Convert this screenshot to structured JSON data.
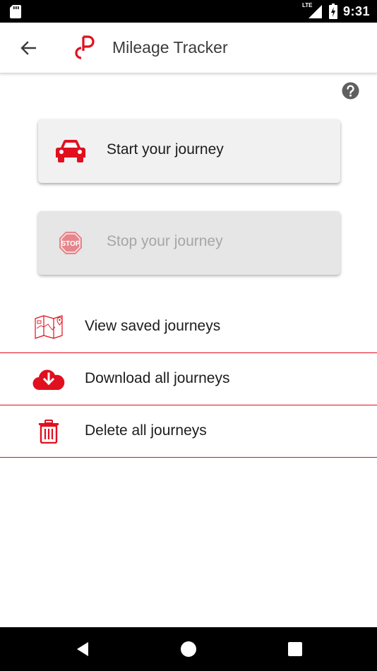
{
  "status_bar": {
    "network": "LTE",
    "time": "9:31",
    "icons": [
      "sd-card-icon",
      "signal-icon",
      "battery-charging-icon"
    ]
  },
  "app_bar": {
    "title": "Mileage Tracker",
    "back_icon": "arrow-back-icon",
    "logo_icon": "app-logo-icon"
  },
  "help_icon": "help-circle-icon",
  "journey_buttons": {
    "start": {
      "label": "Start your journey",
      "icon": "car-icon",
      "enabled": true
    },
    "stop": {
      "label": "Stop your journey",
      "icon": "stop-sign-icon",
      "icon_text": "STOP",
      "enabled": false
    }
  },
  "menu": [
    {
      "label": "View saved journeys",
      "icon": "map-icon"
    },
    {
      "label": "Download all journeys",
      "icon": "cloud-download-icon"
    },
    {
      "label": "Delete all journeys",
      "icon": "trash-icon"
    }
  ],
  "nav_bar": {
    "icons": [
      "nav-back-icon",
      "nav-home-icon",
      "nav-recents-icon"
    ]
  },
  "colors": {
    "accent": "#e0101f",
    "stop_icon": "#e6868c",
    "text_primary": "#1c1c1c",
    "text_disabled": "#a6a6a6",
    "start_bg": "#f1f1f1",
    "stop_bg": "#e6e6e6"
  }
}
